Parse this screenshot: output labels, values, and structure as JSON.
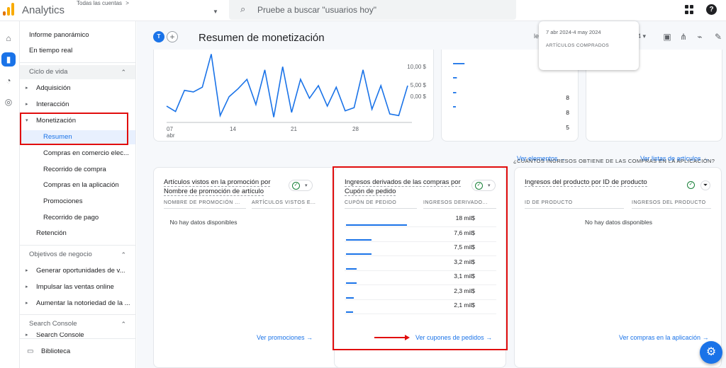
{
  "header": {
    "app_title": "Analytics",
    "account_label": "Todas las cuentas",
    "account_chevron": ">",
    "search_placeholder": "Pruebe a buscar \"usuarios hoy\"",
    "help_glyph": "?"
  },
  "rail": {
    "items": [
      {
        "icon": "home-icon",
        "glyph": "⌂"
      },
      {
        "icon": "reports-icon",
        "glyph": "▮"
      },
      {
        "icon": "explore-icon",
        "glyph": "◔"
      },
      {
        "icon": "advertising-icon",
        "glyph": "◎"
      }
    ]
  },
  "sidebar": {
    "top_items": [
      "Informe panorámico",
      "En tiempo real"
    ],
    "lifecycle": {
      "label": "Ciclo de vida",
      "items": [
        {
          "label": "Adquisición",
          "arrow": "▸"
        },
        {
          "label": "Interacción",
          "arrow": "▸"
        },
        {
          "label": "Monetización",
          "arrow": "▾"
        }
      ],
      "sub_items": [
        "Resumen",
        "Compras en comercio elec...",
        "Recorrido de compra",
        "Compras en la aplicación",
        "Promociones",
        "Recorrido de pago"
      ],
      "retention": "Retención"
    },
    "business": {
      "label": "Objetivos de negocio",
      "items": [
        "Generar oportunidades de v...",
        "Impulsar las ventas online",
        "Aumentar la notoriedad de la ..."
      ]
    },
    "search_console": {
      "label": "Search Console",
      "cut_item": "Search Console"
    },
    "library": "Biblioteca",
    "arrow_glyph": "▸",
    "chevron_up": "⌃"
  },
  "page": {
    "title": "Resumen de monetización",
    "t_badge": "T",
    "plus": "+",
    "head_tools_text": "le",
    "head_tools_suffix": "4 ▾"
  },
  "top_chart": {
    "y_ticks": [
      "10,00 $",
      "5,00 $",
      "0,00 $"
    ],
    "x_ticks": [
      {
        "day": "07",
        "month": "abr"
      },
      {
        "day": "14",
        "month": ""
      },
      {
        "day": "21",
        "month": ""
      },
      {
        "day": "28",
        "month": ""
      }
    ],
    "values": [
      4.5,
      2.8,
      9.5,
      9.0,
      10.5,
      21.0,
      1.5,
      7.5,
      10.0,
      13.0,
      5.0,
      16.0,
      1.0,
      17.0,
      2.5,
      13.0,
      7.0,
      11.0,
      4.5,
      10.5,
      3.0,
      4.0,
      16.0,
      3.5,
      11.0,
      2.0,
      1.5,
      11.0
    ],
    "ymax": 22
  },
  "items_card": {
    "values": [
      "8",
      "8",
      "5"
    ],
    "bar_widths": [
      0.9,
      0.3,
      0.25,
      0.22
    ],
    "link": "Ver elementos →"
  },
  "lists_card": {
    "link": "Ver listas de artículos →"
  },
  "tooltip": {
    "date": "7 abr 2024-4 may 2024",
    "label": "ARTÍCULOS COMPRADOS"
  },
  "section_question": "¿CUÁNTOS INGRESOS OBTIENE DE LAS COMPRAS EN LA APLICACIÓN?",
  "promotions_card": {
    "title_line1": "Artículos vistos en la promoción por",
    "title_line2": "Nombre de promoción de artículo",
    "col1": "NOMBRE DE PROMOCIÓN ...",
    "col2": "ARTÍCULOS VISTOS E...",
    "nodata": "No hay datos disponibles",
    "link": "Ver promociones →"
  },
  "coupons_card": {
    "title_line1": "Ingresos derivados de las compras por",
    "title_line2": "Cupón de pedido",
    "col1": "CUPÓN DE PEDIDO",
    "col2": "INGRESOS DERIVADO...",
    "rows": [
      {
        "value": "18 mil$",
        "num": 18
      },
      {
        "value": "7,6 mil$",
        "num": 7.6
      },
      {
        "value": "7,5 mil$",
        "num": 7.5
      },
      {
        "value": "3,2 mil$",
        "num": 3.2
      },
      {
        "value": "3,1 mil$",
        "num": 3.1
      },
      {
        "value": "2,3 mil$",
        "num": 2.3
      },
      {
        "value": "2,1 mil$",
        "num": 2.1
      }
    ],
    "link": "Ver cupones de pedidos →"
  },
  "product_card": {
    "title": "Ingresos del producto por ID de producto",
    "col1": "ID DE PRODUCTO",
    "col2": "INGRESOS DEL PRODUCTO",
    "nodata": "No hay datos disponibles",
    "link": "Ver compras en la aplicación →"
  },
  "icons": {
    "check": "✓",
    "dropdown": "▾",
    "filter": "⏷",
    "search": "⌕",
    "fab": "⚙"
  },
  "colors": {
    "accent": "#1a73e8",
    "highlight": "#e10d0d",
    "logo_orange": "#f9ab00",
    "logo_dark": "#e37400"
  }
}
